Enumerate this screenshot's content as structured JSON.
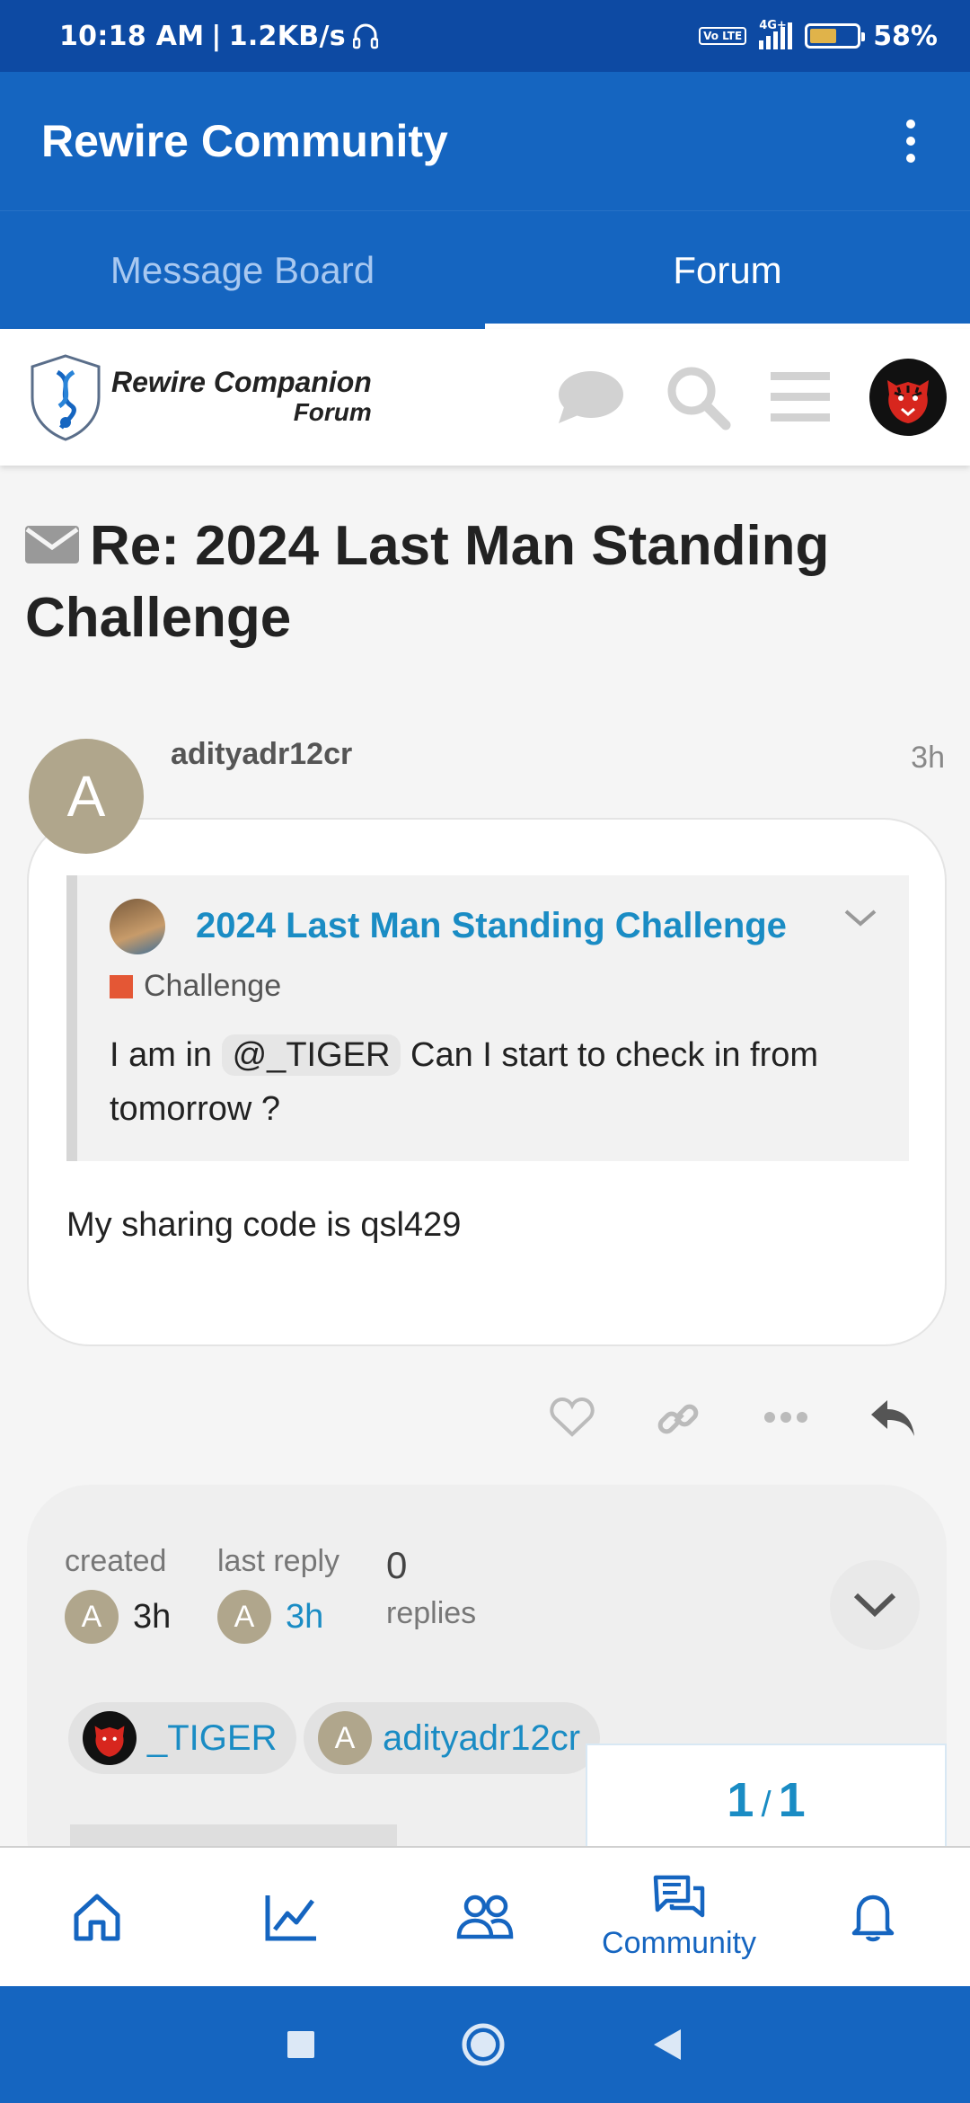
{
  "status_bar": {
    "time": "10:18 AM",
    "speed": "1.2KB/s",
    "network_badge": "Vo LTE",
    "network": "4G+",
    "battery": "58%",
    "battery_level": 0.58
  },
  "app_bar": {
    "title": "Rewire Community",
    "menu_icon": "more-vert-icon"
  },
  "tabs": [
    {
      "label": "Message Board",
      "active": false
    },
    {
      "label": "Forum",
      "active": true
    }
  ],
  "forum_header": {
    "logo_line1": "Rewire Companion",
    "logo_line2": "Forum",
    "icons": [
      "chat-icon",
      "search-icon",
      "hamburger-menu-icon",
      "tiger-avatar"
    ]
  },
  "topic": {
    "prefix": "Re:",
    "title": "2024 Last Man Standing Challenge"
  },
  "post": {
    "avatar_letter": "A",
    "username": "adityadr12cr",
    "time": "3h",
    "quote": {
      "title": "2024 Last Man Standing Challenge",
      "category": "Challenge",
      "category_color": "#e45735",
      "text_before": "I am in",
      "mention": "@_TIGER",
      "text_after": "Can I start to check in from tomorrow ?"
    },
    "body": "My sharing code is qsl429",
    "actions": [
      "like-icon",
      "link-icon",
      "more-icon",
      "reply-icon"
    ]
  },
  "topic_map": {
    "created_label": "created",
    "created_avatar": "A",
    "created_time": "3h",
    "last_reply_label": "last reply",
    "last_reply_avatar": "A",
    "last_reply_time": "3h",
    "replies_count": "0",
    "replies_label": "replies",
    "participants": [
      {
        "name": "_TIGER",
        "avatar": "tiger"
      },
      {
        "name": "adityadr12cr",
        "avatar": "A"
      }
    ]
  },
  "progress": {
    "current": "1",
    "separator": "/",
    "total": "1"
  },
  "bottom_nav": [
    {
      "icon": "home-icon",
      "label": ""
    },
    {
      "icon": "chart-icon",
      "label": ""
    },
    {
      "icon": "people-icon",
      "label": ""
    },
    {
      "icon": "community-icon",
      "label": "Community",
      "active": true
    },
    {
      "icon": "bell-icon",
      "label": ""
    }
  ],
  "colors": {
    "primary": "#1565c0",
    "status_bar": "#0d4aa3",
    "link": "#1a8cc4"
  }
}
